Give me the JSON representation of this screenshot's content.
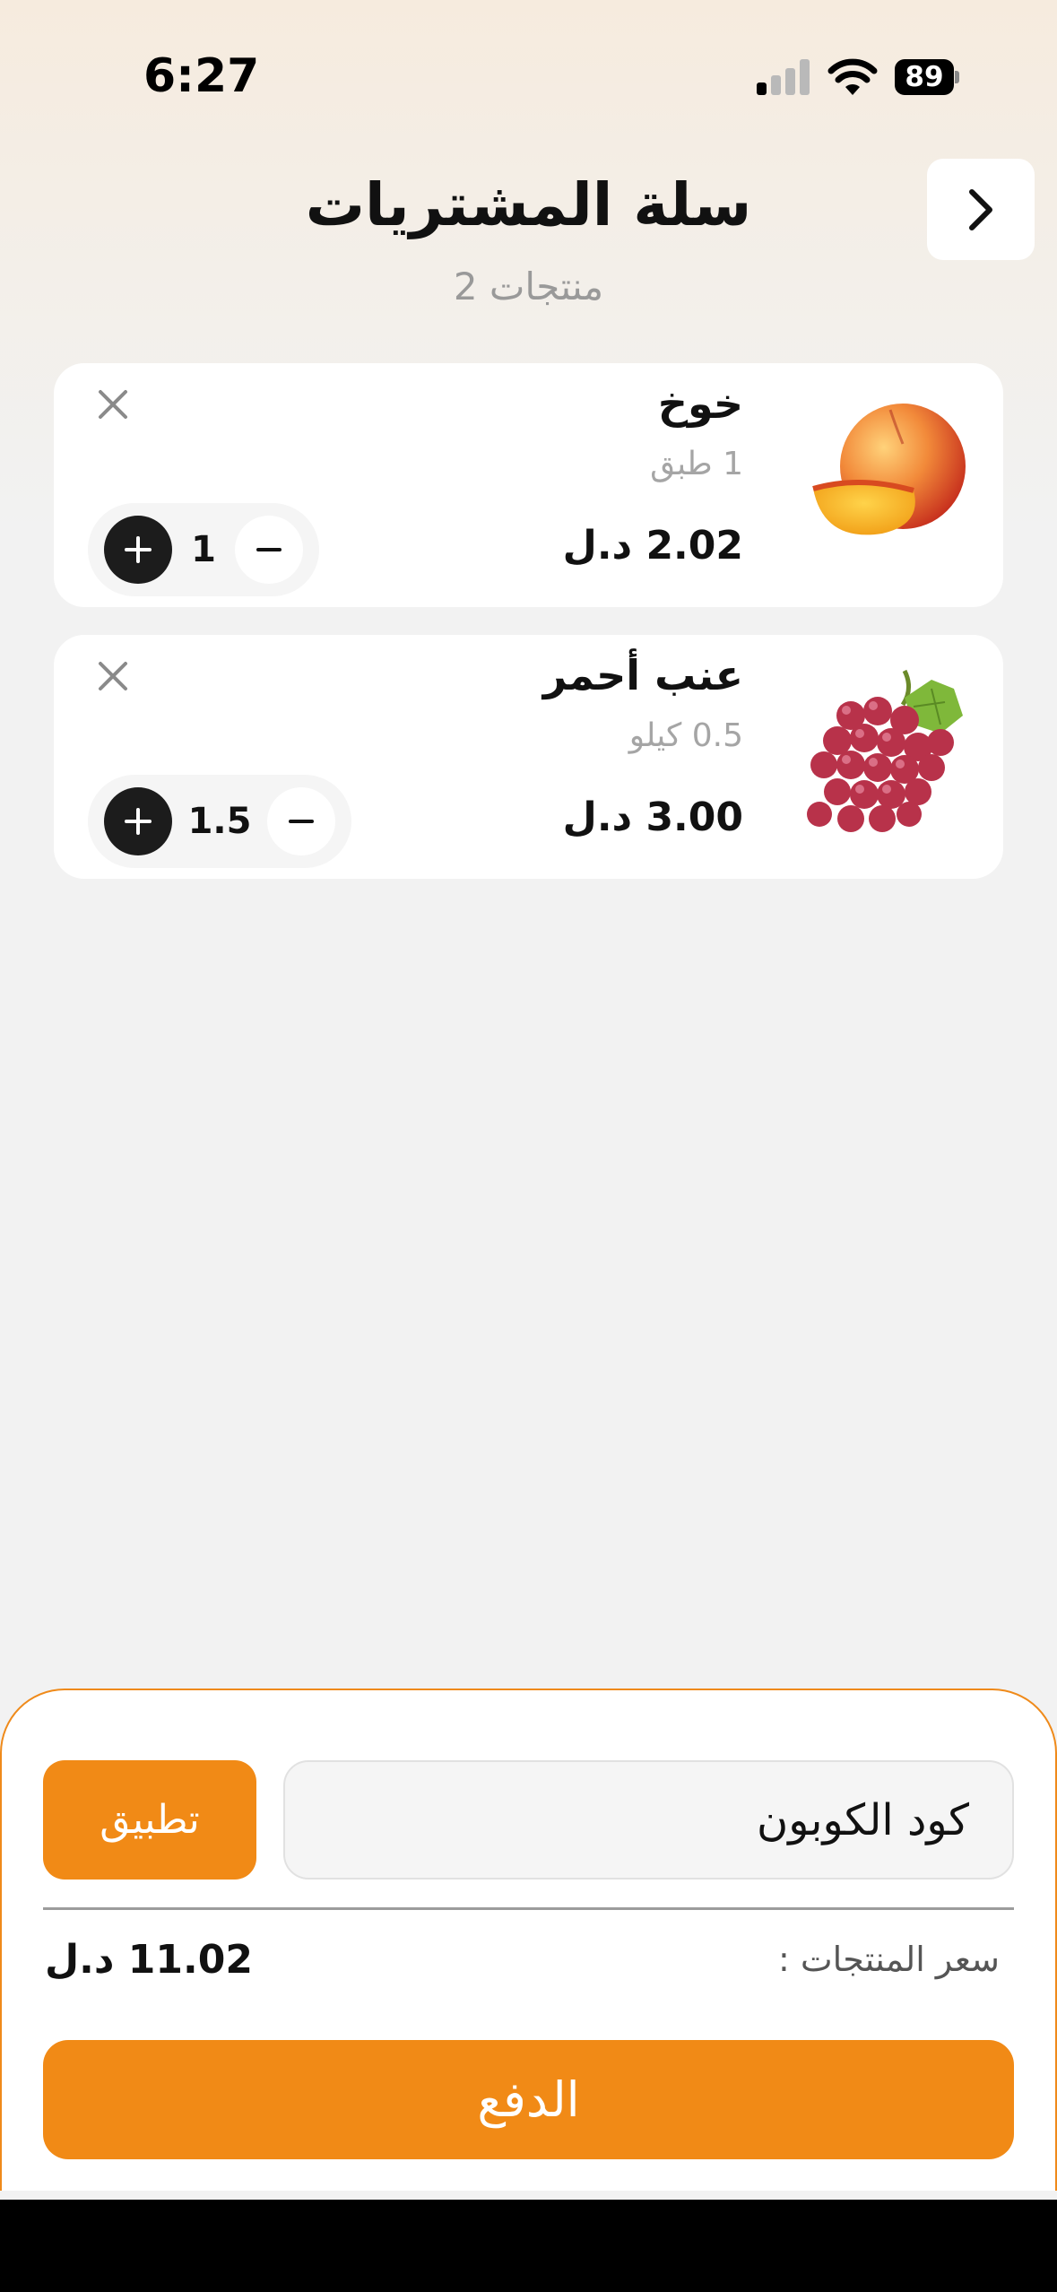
{
  "status_bar": {
    "time": "6:27",
    "battery": "89"
  },
  "header": {
    "title": "سلة المشتريات",
    "subtitle": "2 منتجات"
  },
  "cart": {
    "items": [
      {
        "name": "خوخ",
        "unit": "1 طبق",
        "price": "2.02 د.ل",
        "quantity": "1",
        "image": "peach-image"
      },
      {
        "name": "عنب أحمر",
        "unit": "0.5 كيلو",
        "price": "3.00 د.ل",
        "quantity": "1.5",
        "image": "red-grapes-image"
      }
    ]
  },
  "checkout": {
    "coupon_placeholder": "كود الكوبون",
    "apply_label": "تطبيق",
    "total_label": "سعر المنتجات :",
    "total_value": "11.02 د.ل",
    "pay_label": "الدفع"
  },
  "colors": {
    "accent": "#f18a16",
    "dark": "#1c1c1c",
    "background": "#f2f2f2"
  }
}
